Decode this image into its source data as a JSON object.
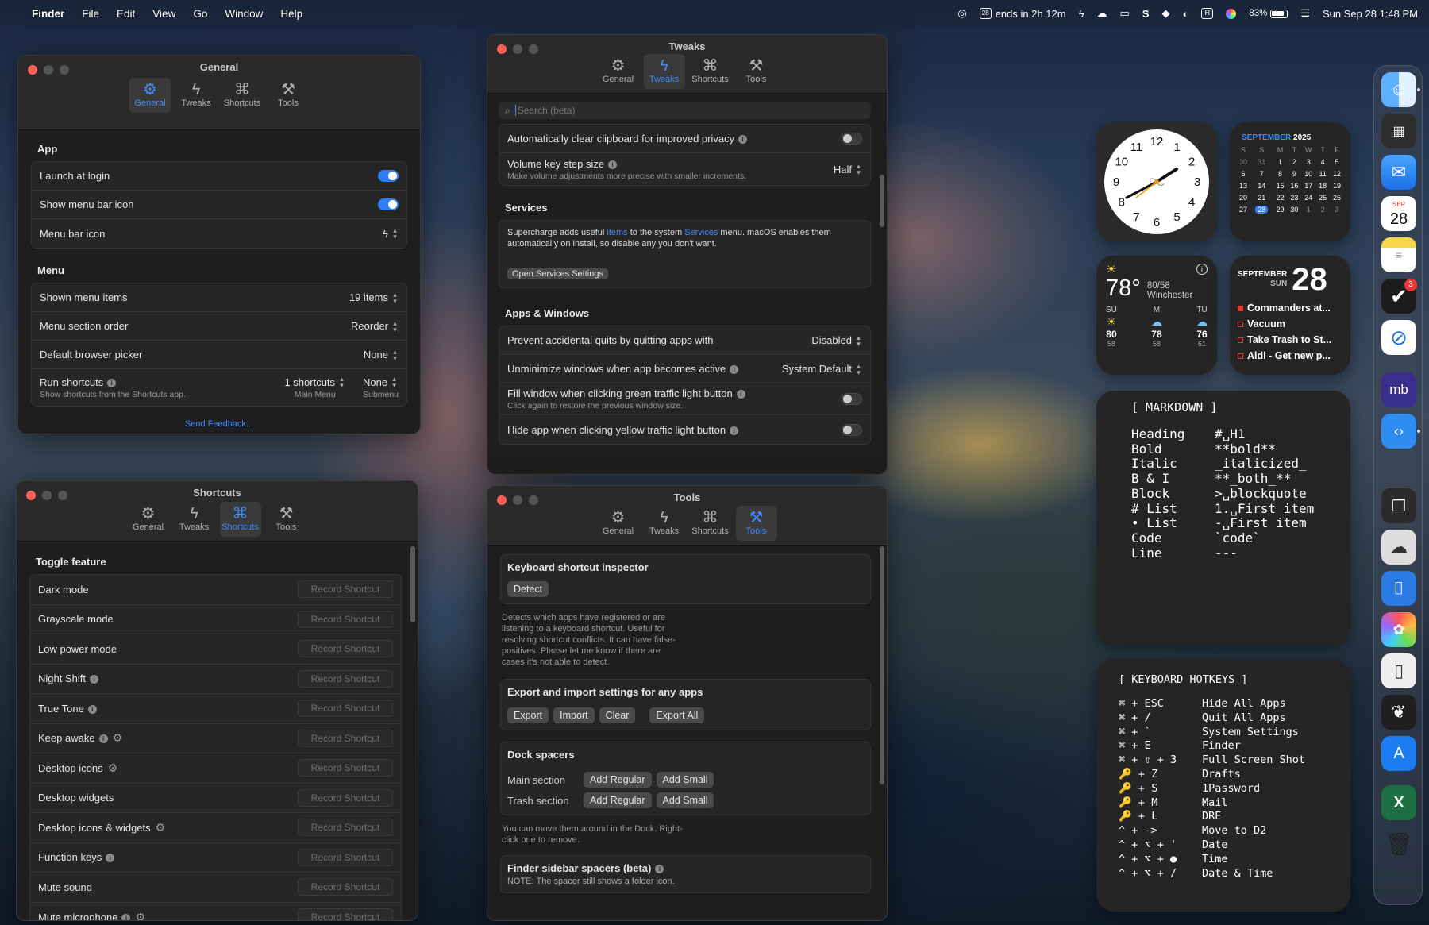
{
  "menubar": {
    "app": "Finder",
    "menus": [
      "File",
      "Edit",
      "View",
      "Go",
      "Window",
      "Help"
    ],
    "cal_badge": "28",
    "timer": "ends in 2h 12m",
    "battery": "83%",
    "clock": "Sun Sep 28  1:48 PM"
  },
  "tabs": [
    "General",
    "Tweaks",
    "Shortcuts",
    "Tools"
  ],
  "general": {
    "title": "General",
    "app_header": "App",
    "launch_at_login": "Launch at login",
    "show_menu_bar_icon": "Show menu bar icon",
    "menu_bar_icon": "Menu bar icon",
    "menu_header": "Menu",
    "shown_menu_items": "Shown menu items",
    "shown_menu_items_value": "19 items",
    "menu_section_order": "Menu section order",
    "menu_section_order_value": "Reorder",
    "default_browser_picker": "Default browser picker",
    "default_browser_picker_value": "None",
    "run_shortcuts": "Run shortcuts",
    "run_shortcuts_sub": "Show shortcuts from the Shortcuts app.",
    "main_menu_value": "1 shortcuts",
    "main_menu_label": "Main Menu",
    "submenu_value": "None",
    "submenu_label": "Submenu",
    "feedback": "Send Feedback..."
  },
  "tweaks": {
    "title": "Tweaks",
    "search_placeholder": "Search (beta)",
    "auto_clear": "Automatically clear clipboard for improved privacy",
    "volume_step": "Volume key step size",
    "volume_step_sub": "Make volume adjustments more precise with smaller increments.",
    "volume_step_value": "Half",
    "services_header": "Services",
    "services_text_1": "Supercharge adds useful ",
    "services_items": "items",
    "services_text_2": " to the system ",
    "services_services": "Services",
    "services_text_3": " menu. macOS enables them automatically on install, so disable any you don't want.",
    "open_services": "Open Services Settings",
    "apps_header": "Apps & Windows",
    "prevent_quits": "Prevent accidental quits by quitting apps with",
    "prevent_quits_value": "Disabled",
    "unminimize": "Unminimize windows when app becomes active",
    "unminimize_value": "System Default",
    "fill_window": "Fill window when clicking green traffic light button",
    "fill_window_sub": "Click again to restore the previous window size.",
    "hide_app": "Hide app when clicking yellow traffic light button"
  },
  "shortcuts": {
    "title": "Shortcuts",
    "header": "Toggle feature",
    "record_label": "Record Shortcut",
    "items": [
      {
        "label": "Dark mode",
        "info": false,
        "gear": false
      },
      {
        "label": "Grayscale mode",
        "info": false,
        "gear": false
      },
      {
        "label": "Low power mode",
        "info": false,
        "gear": false
      },
      {
        "label": "Night Shift",
        "info": true,
        "gear": false
      },
      {
        "label": "True Tone",
        "info": true,
        "gear": false
      },
      {
        "label": "Keep awake",
        "info": true,
        "gear": true
      },
      {
        "label": "Desktop icons",
        "info": false,
        "gear": true
      },
      {
        "label": "Desktop widgets",
        "info": false,
        "gear": false
      },
      {
        "label": "Desktop icons & widgets",
        "info": false,
        "gear": true
      },
      {
        "label": "Function keys",
        "info": true,
        "gear": false
      },
      {
        "label": "Mute sound",
        "info": false,
        "gear": false
      },
      {
        "label": "Mute microphone",
        "info": true,
        "gear": true
      }
    ]
  },
  "tools": {
    "title": "Tools",
    "inspector_header": "Keyboard shortcut inspector",
    "detect": "Detect",
    "inspector_desc": "Detects which apps have registered or are listening to a keyboard shortcut. Useful for resolving shortcut conflicts. It can have false-positives. Please let me know if there are cases it's not able to detect.",
    "export_header": "Export and import settings for any apps",
    "export": "Export",
    "import": "Import",
    "clear": "Clear",
    "export_all": "Export All",
    "dock_header": "Dock spacers",
    "main_section": "Main section",
    "trash_section": "Trash section",
    "add_regular": "Add Regular",
    "add_small": "Add Small",
    "dock_desc": "You can move them around in the Dock. Right-click one to remove.",
    "finder_header": "Finder sidebar spacers (beta)",
    "finder_note": "NOTE: The spacer still shows a folder icon."
  },
  "clock_widget": {
    "label": "DC",
    "numbers": [
      "12",
      "1",
      "2",
      "3",
      "4",
      "5",
      "6",
      "7",
      "8",
      "9",
      "10",
      "11"
    ]
  },
  "calendar_widget": {
    "month": "SEPTEMBER",
    "year": "2025",
    "days": [
      "S",
      "S",
      "M",
      "T",
      "W",
      "T",
      "F"
    ],
    "weeks": [
      [
        "30",
        "31",
        "1",
        "2",
        "3",
        "4",
        "5"
      ],
      [
        "6",
        "7",
        "8",
        "9",
        "10",
        "11",
        "12"
      ],
      [
        "13",
        "14",
        "15",
        "16",
        "17",
        "18",
        "19"
      ],
      [
        "20",
        "21",
        "22",
        "23",
        "24",
        "25",
        "26"
      ],
      [
        "27",
        "28",
        "29",
        "30",
        "1",
        "2",
        "3"
      ]
    ]
  },
  "weather_widget": {
    "temp": "78°",
    "hilo": "80/58",
    "city": "Winchester",
    "days": [
      {
        "day": "SU",
        "hi": "80",
        "lo": "58"
      },
      {
        "day": "M",
        "hi": "78",
        "lo": "58"
      },
      {
        "day": "TU",
        "hi": "76",
        "lo": "61"
      }
    ]
  },
  "reminders_widget": {
    "month": "SEPTEMBER",
    "weekday": "SUN",
    "date": "28",
    "items": [
      "Commanders at...",
      "Vacuum",
      "Take Trash to St...",
      "Aldi - Get new p..."
    ]
  },
  "markdown_widget": {
    "title": "[ MARKDOWN ]",
    "rows": [
      {
        "k": "Heading",
        "v": "#␣H1"
      },
      {
        "k": "Bold",
        "v": "**bold**"
      },
      {
        "k": "Italic",
        "v": "_italicized_"
      },
      {
        "k": "B & I",
        "v": "**_both_**"
      },
      {
        "k": "Block",
        "v": ">␣blockquote"
      },
      {
        "k": "# List",
        "v": "1.␣First item"
      },
      {
        "k": "• List",
        "v": "-␣First item"
      },
      {
        "k": "Code",
        "v": "`code`"
      },
      {
        "k": "Line",
        "v": "---"
      }
    ]
  },
  "hotkeys_widget": {
    "title": "[ KEYBOARD HOTKEYS ]",
    "rows": [
      {
        "k": "⌘ + ESC",
        "v": "Hide All Apps"
      },
      {
        "k": "⌘ + /",
        "v": "Quit All Apps"
      },
      {
        "k": "⌘ + `",
        "v": "System Settings"
      },
      {
        "k": "⌘ + E",
        "v": "Finder"
      },
      {
        "k": "⌘ + ⇧ + 3",
        "v": "Full Screen Shot"
      },
      {
        "k": "🔑 + Z",
        "v": "Drafts"
      },
      {
        "k": "🔑 + S",
        "v": "1Password"
      },
      {
        "k": "🔑 + M",
        "v": "Mail"
      },
      {
        "k": "🔑 + L",
        "v": "DRE"
      },
      {
        "k": "^ + ->",
        "v": "Move to D2"
      },
      {
        "k": "^ + ⌥ + '",
        "v": "Date"
      },
      {
        "k": "^ + ⌥ + ●",
        "v": "Time"
      },
      {
        "k": "^ + ⌥ + /",
        "v": "Date & Time"
      }
    ]
  },
  "dock": {
    "calendar_month": "SEP",
    "calendar_day": "28",
    "tasks_badge": "3",
    "mb_label": "mb"
  }
}
